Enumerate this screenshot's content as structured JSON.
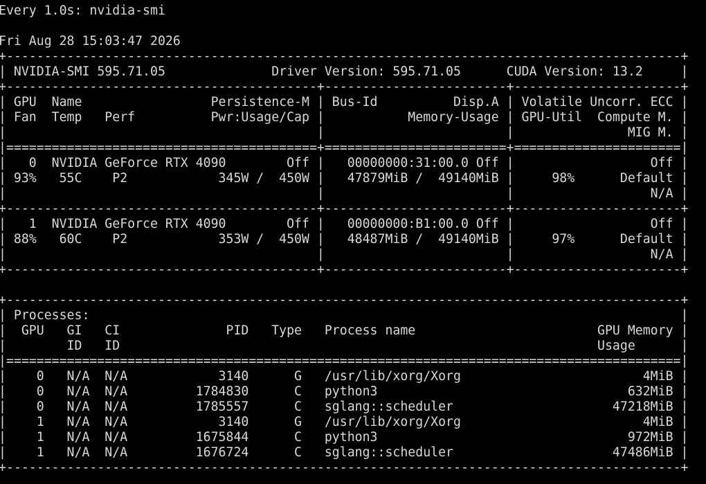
{
  "terminal": {
    "lines": [
      "Every 1.0s: nvidia-smi",
      "",
      "Fri Aug 28 15:03:47 2026",
      "+-----------------------------------------------------------------------------------------+",
      "| NVIDIA-SMI 595.71.05              Driver Version: 595.71.05      CUDA Version: 13.2     |",
      "+-----------------------------------------+------------------------+----------------------+",
      "| GPU  Name                 Persistence-M | Bus-Id          Disp.A | Volatile Uncorr. ECC |",
      "| Fan  Temp   Perf          Pwr:Usage/Cap |           Memory-Usage | GPU-Util  Compute M. |",
      "|                                         |                        |               MIG M. |",
      "|=========================================+========================+======================|",
      "|   0  NVIDIA GeForce RTX 4090        Off |   00000000:31:00.0 Off |                  Off |",
      "| 93%   55C    P2            345W /  450W |   47879MiB /  49140MiB |     98%      Default |",
      "|                                         |                        |                  N/A |",
      "+-----------------------------------------+------------------------+----------------------+",
      "|   1  NVIDIA GeForce RTX 4090        Off |   00000000:B1:00.0 Off |                  Off |",
      "| 88%   60C    P2            353W /  450W |   48487MiB /  49140MiB |     97%      Default |",
      "|                                         |                        |                  N/A |",
      "+-----------------------------------------+------------------------+----------------------+",
      "",
      "+-----------------------------------------------------------------------------------------+",
      "| Processes:                                                                              |",
      "|  GPU   GI   CI              PID   Type   Process name                        GPU Memory |",
      "|        ID   ID                                                               Usage      |",
      "|=========================================================================================|",
      "|    0   N/A  N/A            3140      G   /usr/lib/xorg/Xorg                        4MiB |",
      "|    0   N/A  N/A         1784830      C   python3                                 632MiB |",
      "|    0   N/A  N/A         1785557      C   sglang::scheduler                     47218MiB |",
      "|    1   N/A  N/A            3140      G   /usr/lib/xorg/Xorg                        4MiB |",
      "|    1   N/A  N/A         1675844      C   python3                                 972MiB |",
      "|    1   N/A  N/A         1676724      C   sglang::scheduler                     47486MiB |",
      "+-----------------------------------------------------------------------------------------+"
    ]
  },
  "colors": {
    "background": "#000000",
    "text": "#d9d9d9"
  }
}
